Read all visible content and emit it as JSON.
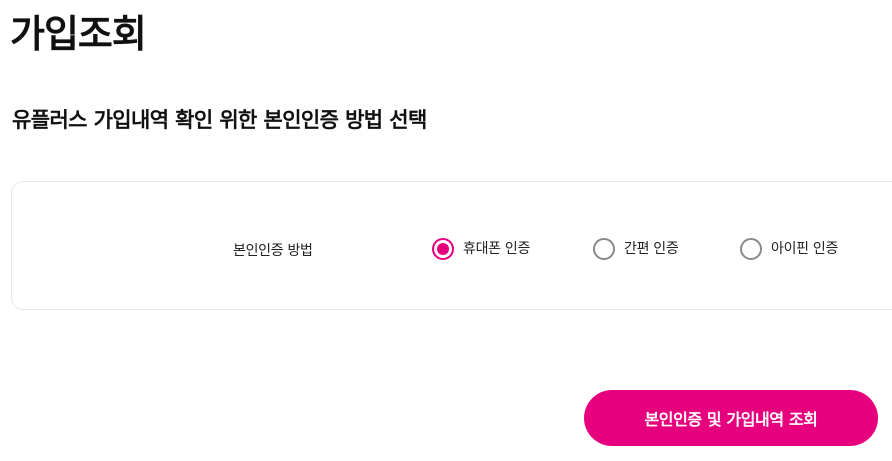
{
  "page": {
    "title": "가입조회",
    "heading": "유플러스 가입내역 확인 위한 본인인증 방법 선택"
  },
  "auth": {
    "label": "본인인증 방법",
    "options": [
      {
        "label": "휴대폰 인증",
        "selected": true
      },
      {
        "label": "간편 인증",
        "selected": false
      },
      {
        "label": "아이핀 인증",
        "selected": false
      }
    ]
  },
  "actions": {
    "submit_label": "본인인증 및 가입내역 조회"
  },
  "colors": {
    "accent": "#e6007e",
    "radio_unselected": "#8a8a8a",
    "card_border": "#e6e6e6"
  }
}
